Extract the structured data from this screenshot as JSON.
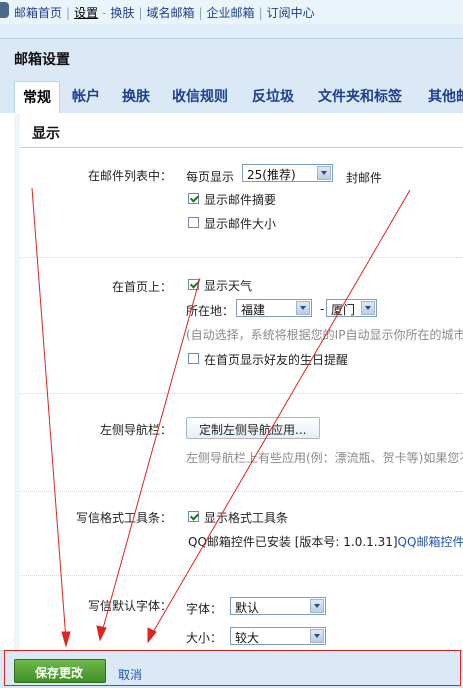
{
  "topnav": {
    "links": [
      "邮箱首页",
      "设置",
      "换肤",
      "域名邮箱",
      "企业邮箱",
      "订阅中心"
    ],
    "separators": [
      "|",
      "-",
      "|",
      "|",
      "|"
    ]
  },
  "page_title": "邮箱设置",
  "tabs": [
    "常规",
    "帐户",
    "换肤",
    "收信规则",
    "反垃圾",
    "文件夹和标签",
    "其他邮"
  ],
  "section_title": "显示",
  "mail_list": {
    "label": "在邮件列表中：",
    "per_page_prefix": "每页显示",
    "per_page_value": "25(推荐)",
    "per_page_suffix": "封邮件",
    "show_summary": "显示邮件摘要",
    "show_size": "显示邮件大小"
  },
  "homepage": {
    "label": "在首页上：",
    "show_weather": "显示天气",
    "location_label": "所在地：",
    "province": "福建",
    "dash": "-",
    "city": "厦门",
    "hint": "(自动选择，系统将根据您的IP自动显示你所在的城市",
    "birthday": "在首页显示好友的生日提醒"
  },
  "leftnav": {
    "label": "左侧导航栏：",
    "button": "定制左侧导航应用...",
    "hint": "左侧导航栏上有些应用(例：漂流瓶、贺卡等)如果您不"
  },
  "format_toolbar": {
    "label": "写信格式工具条：",
    "show_toolbar": "显示格式工具条",
    "installed": "QQ邮箱控件已安装 [版本号: 1.0.1.31]",
    "link": "QQ邮箱控件"
  },
  "default_font": {
    "label": "写信默认字体：",
    "font_label": "字体：",
    "font_value": "默认",
    "size_label": "大小：",
    "size_value": "较大"
  },
  "footer": {
    "save": "保存更改",
    "cancel": "取消"
  },
  "colors": {
    "annotation": "#e0231f",
    "save_green": "#4a9a2f",
    "link_blue": "#1f55b3"
  }
}
